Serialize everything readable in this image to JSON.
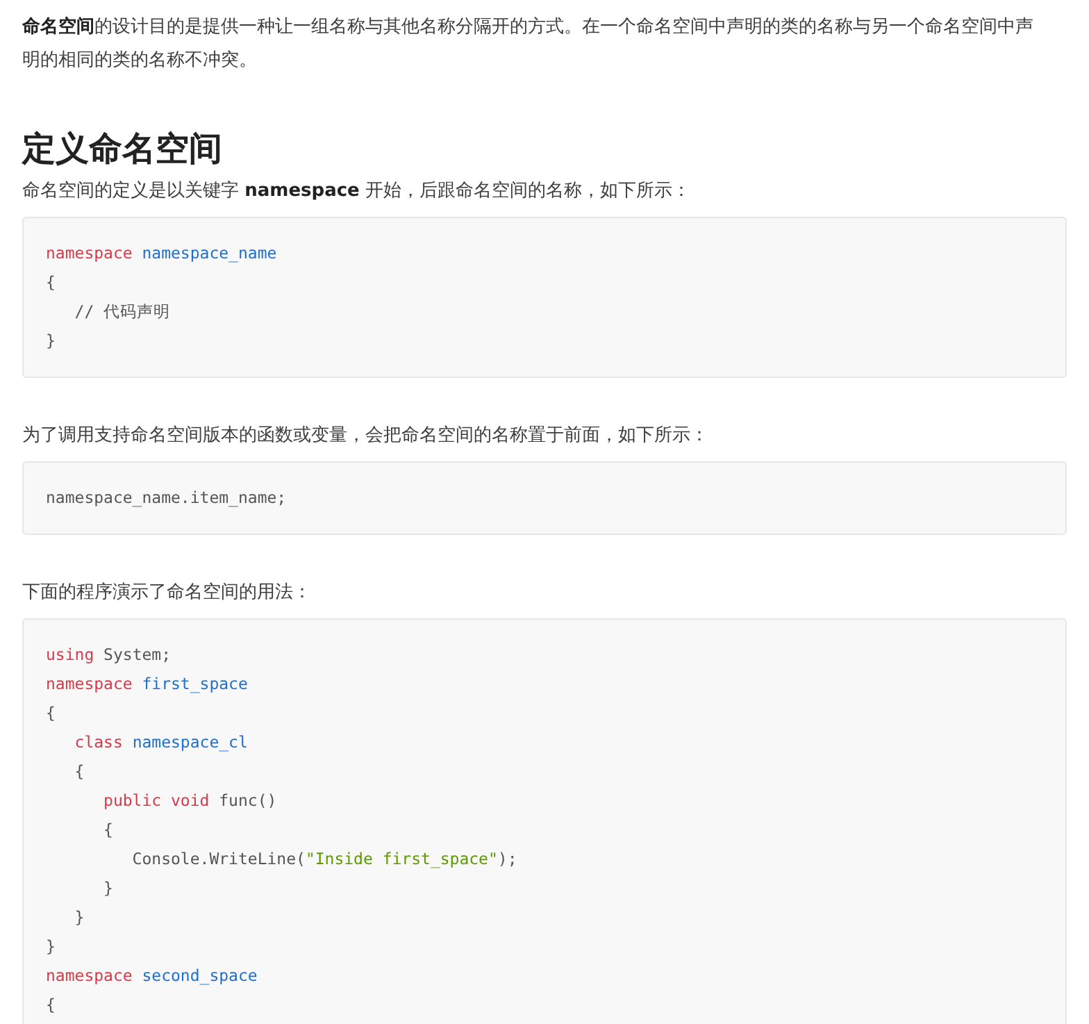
{
  "intro": "**命名空间**的设计目的是提供一种让一组名称与其他名称分隔开的方式。在一个命名空间中声明的类的名称与另一个命名空间中声明的相同的类的名称不冲突。",
  "heading": "定义命名空间",
  "blocks": [
    {
      "kind": "paragraph",
      "text": "命名空间的定义是以关键字 **namespace** 开始，后跟命名空间的名称，如下所示："
    },
    {
      "kind": "code",
      "lines": [
        [
          {
            "kind": "keyword",
            "text": "namespace"
          },
          {
            "kind": "name",
            "text": " namespace_name"
          }
        ],
        [
          {
            "kind": "plain",
            "text": "{"
          }
        ],
        [
          {
            "kind": "plain",
            "text": "   // 代码声明"
          }
        ],
        [
          {
            "kind": "plain",
            "text": "}"
          }
        ]
      ]
    },
    {
      "kind": "paragraph",
      "text": "为了调用支持命名空间版本的函数或变量，会把命名空间的名称置于前面，如下所示："
    },
    {
      "kind": "code",
      "lines": [
        [
          {
            "kind": "plain",
            "text": "namespace_name.item_name;"
          }
        ]
      ]
    },
    {
      "kind": "paragraph",
      "text": "下面的程序演示了命名空间的用法："
    },
    {
      "kind": "code",
      "lines": [
        [
          {
            "kind": "keyword",
            "text": "using"
          },
          {
            "kind": "plain",
            "text": " System;"
          }
        ],
        [
          {
            "kind": "keyword",
            "text": "namespace"
          },
          {
            "kind": "name",
            "text": " first_space"
          }
        ],
        [
          {
            "kind": "plain",
            "text": "{"
          }
        ],
        [
          {
            "kind": "keyword",
            "text": "   class"
          },
          {
            "kind": "name",
            "text": " namespace_cl"
          }
        ],
        [
          {
            "kind": "plain",
            "text": "   {"
          }
        ],
        [
          {
            "kind": "keyword",
            "text": "      public void"
          },
          {
            "kind": "plain",
            "text": " func()"
          }
        ],
        [
          {
            "kind": "plain",
            "text": "      {"
          }
        ],
        [
          {
            "kind": "plain",
            "text": "         Console.WriteLine("
          },
          {
            "kind": "string",
            "text": "\"Inside first_space\""
          },
          {
            "kind": "plain",
            "text": ");"
          }
        ],
        [
          {
            "kind": "plain",
            "text": "      }"
          }
        ],
        [
          {
            "kind": "plain",
            "text": "   }"
          }
        ],
        [
          {
            "kind": "plain",
            "text": "}"
          }
        ],
        [
          {
            "kind": "keyword",
            "text": "namespace"
          },
          {
            "kind": "name",
            "text": " second_space"
          }
        ],
        [
          {
            "kind": "plain",
            "text": "{"
          }
        ]
      ]
    }
  ]
}
